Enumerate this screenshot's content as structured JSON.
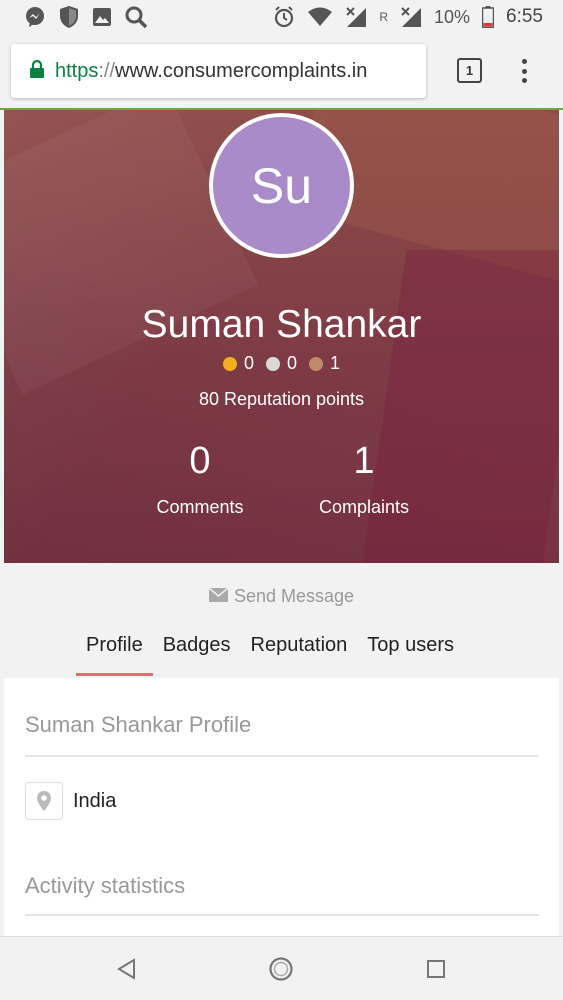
{
  "status_bar": {
    "left_icons": [
      "messenger-icon",
      "shield-icon",
      "image-icon",
      "search-icon"
    ],
    "roaming": "R",
    "battery_percent": "10%",
    "time": "6:55"
  },
  "browser": {
    "url_scheme": "https",
    "url_sep": "://",
    "url_host": "www.consumercomplaints.in",
    "tab_count": "1"
  },
  "profile": {
    "initials": "Su",
    "name": "Suman Shankar",
    "badges": [
      {
        "color": "#f2b01e",
        "count": "0"
      },
      {
        "color": "#d9d9d9",
        "count": "0"
      },
      {
        "color": "#c08a6a",
        "count": "1"
      }
    ],
    "reputation": "80 Reputation points",
    "stats": {
      "comments_count": "0",
      "comments_label": "Comments",
      "complaints_count": "1",
      "complaints_label": "Complaints"
    },
    "avatar_color": "#a98bc9"
  },
  "send_message": "Send Message",
  "tabs": [
    {
      "label": "Profile",
      "active": true
    },
    {
      "label": "Badges",
      "active": false
    },
    {
      "label": "Reputation",
      "active": false
    },
    {
      "label": "Top users",
      "active": false
    }
  ],
  "details": {
    "profile_title": "Suman Shankar Profile",
    "location": "India",
    "activity_title": "Activity statistics"
  }
}
